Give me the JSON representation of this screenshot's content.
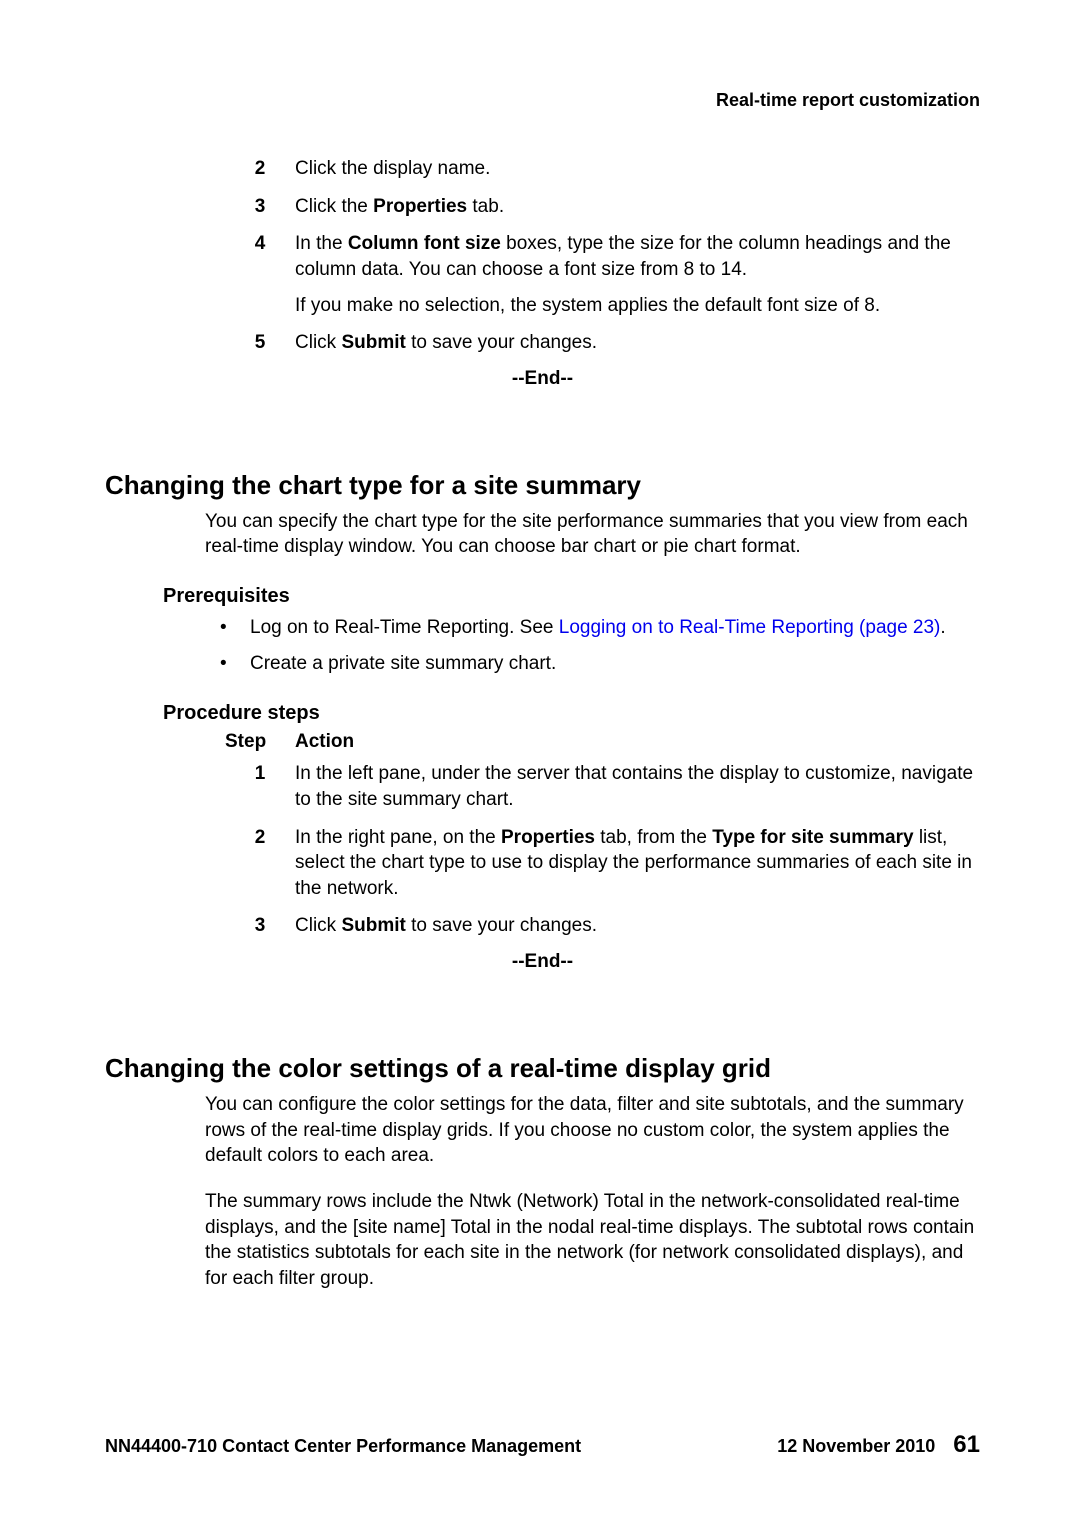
{
  "header": {
    "title": "Real-time report customization"
  },
  "topSteps": {
    "items": [
      {
        "num": "2",
        "paras": [
          "Click the display name."
        ]
      },
      {
        "num": "3",
        "paras": [
          "Click the <b>Properties</b> tab."
        ]
      },
      {
        "num": "4",
        "paras": [
          "In the <b>Column font size</b> boxes, type the size for the column headings and the column data. You can choose a font size from 8 to 14.",
          "If you make no selection, the system applies the default font size of 8."
        ]
      },
      {
        "num": "5",
        "paras": [
          "Click <b>Submit</b> to save your changes."
        ]
      }
    ],
    "end": "--End--"
  },
  "section1": {
    "heading": "Changing the chart type for a site summary",
    "intro": "You can specify the chart type for the site performance summaries that you view from each real-time display window. You can choose bar chart or pie chart format.",
    "prereqHeading": "Prerequisites",
    "prereqs": [
      {
        "text": "Log on to Real-Time Reporting. See ",
        "link": "Logging on to Real-Time Reporting (page 23)",
        "after": "."
      },
      {
        "text": "Create a private site summary chart."
      }
    ],
    "procHeading": "Procedure steps",
    "tableHeader": {
      "step": "Step",
      "action": "Action"
    },
    "steps": [
      {
        "num": "1",
        "paras": [
          "In the left pane, under the server that contains the display to customize, navigate to the site summary chart."
        ]
      },
      {
        "num": "2",
        "paras": [
          "In the right pane, on the <b>Properties</b> tab, from the <b>Type for site summary</b> list, select the chart type to use to display the performance summaries of each site in the network."
        ]
      },
      {
        "num": "3",
        "paras": [
          "Click <b>Submit</b> to save your changes."
        ]
      }
    ],
    "end": "--End--"
  },
  "section2": {
    "heading": "Changing the color settings of a real-time display grid",
    "paras": [
      "You can configure the color settings for the data, filter and site subtotals, and the summary rows of the real-time display grids. If you choose no custom color, the system applies the default colors to each area.",
      "The summary rows include the Ntwk (Network) Total in the network-consolidated real-time displays, and the [site name] Total in the nodal real-time displays. The subtotal rows contain the statistics subtotals for each site in the network (for network consolidated displays), and for each filter group."
    ]
  },
  "footer": {
    "left": "NN44400-710 Contact Center Performance Management",
    "date": "12 November 2010",
    "page": "61"
  }
}
